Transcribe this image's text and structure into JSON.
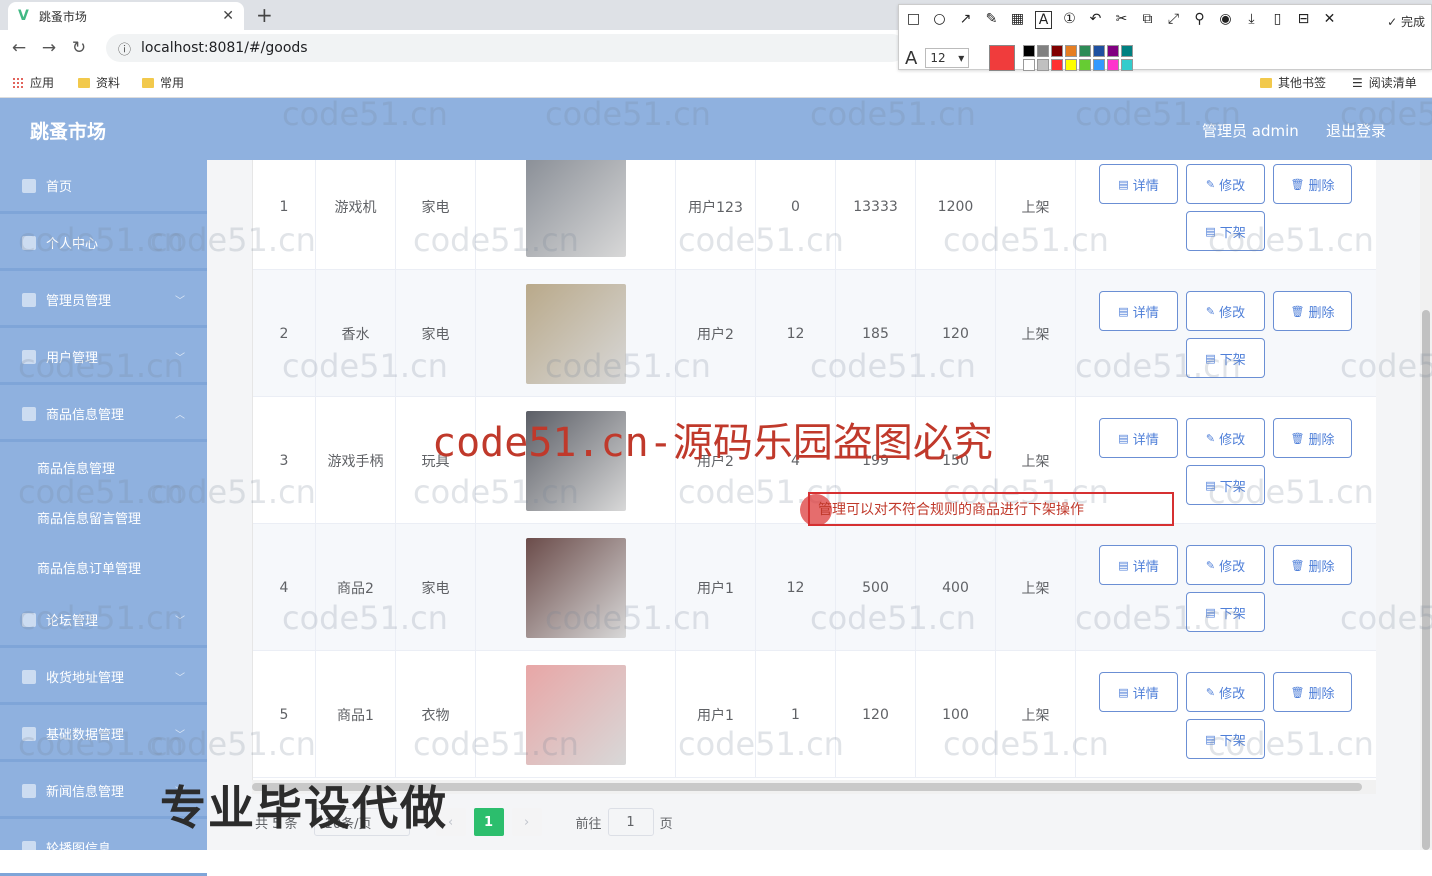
{
  "browser": {
    "tab_title": "跳蚤市场",
    "url_prefix": "localhost",
    "url": "localhost:8081/#/goods",
    "bookmarks": [
      "应用",
      "资料",
      "常用"
    ],
    "bookmarks_right": [
      "其他书签",
      "阅读清单"
    ]
  },
  "snap_tool": {
    "done_label": "完成",
    "font_size": "12",
    "current_color": "#f03c3c",
    "palette": [
      "#000000",
      "#808080",
      "#800000",
      "#e67e22",
      "#2e8b57",
      "#1e50a0",
      "#800080",
      "#008080",
      "#ffffff",
      "#c0c0c0",
      "#ff3030",
      "#ffff00",
      "#66cc33",
      "#3399ff",
      "#ff33cc",
      "#33cccc"
    ]
  },
  "header": {
    "brand": "跳蚤市场",
    "admin": "管理员 admin",
    "logout": "退出登录"
  },
  "sidebar": {
    "items": [
      {
        "label": "首页"
      },
      {
        "label": "个人中心"
      },
      {
        "label": "管理员管理"
      },
      {
        "label": "用户管理"
      },
      {
        "label": "商品信息管理"
      },
      {
        "label": "论坛管理"
      },
      {
        "label": "收货地址管理"
      },
      {
        "label": "基础数据管理"
      },
      {
        "label": "新闻信息管理"
      },
      {
        "label": "轮播图信息"
      }
    ],
    "sub_items": [
      "商品信息管理",
      "商品信息留言管理",
      "商品信息订单管理"
    ]
  },
  "table": {
    "rows": [
      {
        "idx": "1",
        "name": "游戏机",
        "type": "家电",
        "user": "用户123",
        "c1": "0",
        "c2": "13333",
        "c3": "1200",
        "status": "上架",
        "img": "#8a8f97"
      },
      {
        "idx": "2",
        "name": "香水",
        "type": "家电",
        "user": "用户2",
        "c1": "12",
        "c2": "185",
        "c3": "120",
        "status": "上架",
        "img": "#b9a98a"
      },
      {
        "idx": "3",
        "name": "游戏手柄",
        "type": "玩具",
        "user": "用户2",
        "c1": "4",
        "c2": "199",
        "c3": "150",
        "status": "上架",
        "img": "#5b5e66"
      },
      {
        "idx": "4",
        "name": "商品2",
        "type": "家电",
        "user": "用户1",
        "c1": "12",
        "c2": "500",
        "c3": "400",
        "status": "上架",
        "img": "#6b4c4a"
      },
      {
        "idx": "5",
        "name": "商品1",
        "type": "衣物",
        "user": "用户1",
        "c1": "1",
        "c2": "120",
        "c3": "100",
        "status": "上架",
        "img": "#e8a6a6"
      }
    ],
    "buttons": {
      "detail": "详情",
      "edit": "修改",
      "delete": "删除",
      "off_shelf": "下架"
    }
  },
  "pagination": {
    "total": "共 5 条",
    "size": "10条/页",
    "current": "1",
    "goto_label": "前往",
    "goto_value": "1",
    "page_suffix": "页"
  },
  "overlays": {
    "watermark": "code51.cn",
    "big_watermark": "code51.cn-源码乐园盗图必究",
    "note": "管理可以对不符合规则的商品进行下架操作",
    "corner": "专业毕设代做"
  }
}
